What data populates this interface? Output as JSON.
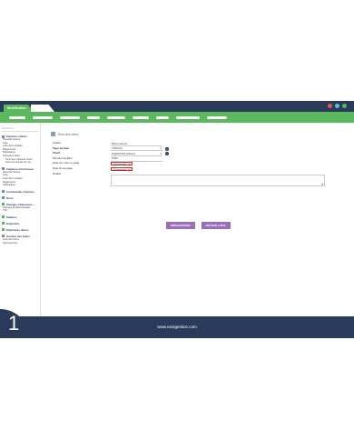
{
  "app": {
    "tab_label": "NextGestion"
  },
  "colors": {
    "nav_green": "#5cb85c",
    "titlebar_navy": "#2a3a5b",
    "button_purple": "#9b6fb5",
    "highlight_red": "#c9302c"
  },
  "window_controls": [
    "#e8534b",
    "#4fc3d9",
    "#5cb85c"
  ],
  "sidebar": {
    "search_placeholder": "Rechercher",
    "sections": [
      {
        "title": "Factures clients",
        "items": [
          "Nouvelle facture",
          "Liste",
          "Liste des modèles",
          "Règlements",
          "Statistiques",
          "Nouveaux états",
          "Suivi des créances client",
          "Suivi des achats de cré..."
        ],
        "indent_from": 6
      },
      {
        "title": "Factures fournisseur",
        "items": [
          "Nouvelle facture",
          "Liste",
          "Liste des modèles",
          "Règlements",
          "Statistiques"
        ],
        "indent_from": 99
      },
      {
        "title": "Commandes fourniss",
        "items": [],
        "indent_from": 99
      },
      {
        "title": "Dons",
        "items": [],
        "indent_from": 99
      },
      {
        "title": "Charges | Dépenses ...",
        "items": [
          "Charges fiscales/sociales",
          "TVA"
        ],
        "indent_from": 99
      },
      {
        "title": "Salaires",
        "items": [],
        "indent_from": 99
      },
      {
        "title": "Emprunts",
        "items": [],
        "indent_from": 99
      },
      {
        "title": "Paiements divers",
        "items": [],
        "indent_from": 99
      },
      {
        "title": "Gestion des biens",
        "items": [
          "Liste des biens",
          "Nouveau bien"
        ],
        "indent_from": 99
      }
    ]
  },
  "page": {
    "title": "Suivi des biens",
    "fields": {
      "libelle": {
        "label": "Libellé",
        "value": "Micro-pieces"
      },
      "type": {
        "label": "Type de bien",
        "value": "Véhicule"
      },
      "client": {
        "label": "Client",
        "value": "SOMACOS (Client)"
      },
      "montant": {
        "label": "Montant de Bien",
        "value": "1000"
      },
      "date_mise": {
        "label": "Date de mise en gage",
        "value": "17/06/2023"
      },
      "date_fin": {
        "label": "Date fin de gage",
        "value": "21/06/2023"
      },
      "detail": {
        "label": "Détails",
        "value": ""
      }
    },
    "buttons": {
      "save": "ENREGISTRER",
      "back": "RETOUR LISTE"
    }
  },
  "footer": {
    "url": "www.nextgestion.com"
  },
  "step_number": "1"
}
